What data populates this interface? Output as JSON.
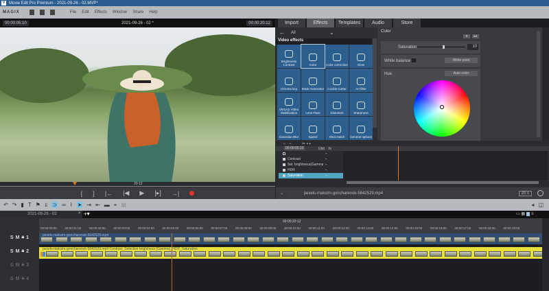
{
  "window": {
    "title": "Movie Edit Pro Premium - 2021-09-26 - 02.MVP*"
  },
  "menu": {
    "brand": "MAGIX",
    "items": [
      "File",
      "Edit",
      "Effects",
      "Window",
      "Share",
      "Help"
    ]
  },
  "preview": {
    "timecode_left": "00:00:05:10",
    "title": "2021-09-26 - 02 *",
    "timecode_right": "00:00:20:12",
    "scrub_time": "20:12",
    "position_fraction": 0.27
  },
  "tabs": [
    "Import",
    "Effects",
    "Templates",
    "Audio",
    "Store"
  ],
  "active_tab": "Effects",
  "effects": {
    "filter": "All",
    "section": "Video effects",
    "items": [
      "Brightness/ Contrast",
      "Color",
      "Color correction",
      "Glow",
      "Chroma key",
      "Mask Generator",
      "Cookie Cutter",
      "Art filter",
      "VEGAS Video Stabilization",
      "Lens Flare",
      "Distortion",
      "Sharpness",
      "Gaussian Blur",
      "Speed",
      "Shot match",
      "General options"
    ],
    "selected": "Color"
  },
  "color_panel": {
    "title": "Color",
    "saturation_label": "Saturation",
    "saturation_value": "10",
    "white_balance_label": "White balance",
    "white_point_button": "White point",
    "hue_label": "Hue",
    "auto_color_button": "Auto color"
  },
  "keyframes": {
    "timecode": "00:00:05:10",
    "col_unit": "Unit",
    "col_fx": "fx",
    "rows": [
      "",
      "Contrast",
      "Sel. brightness(Gamma)",
      "HDR",
      "Saturation"
    ]
  },
  "bottom": {
    "file": "pexels-maksim-goncharenok-5642529.mp4",
    "zoom": "20 s"
  },
  "project_tab": "2021-09-26 - 02",
  "timeline": {
    "cursor": "00:00:20:12",
    "ticks": [
      "00:00:00:00",
      "00:00:01:00",
      "00:00:02:00",
      "00:00:03:00",
      "00:00:04:00",
      "00:00:05:00",
      "00:00:06:00",
      "00:00:07:00",
      "00:00:08:00",
      "00:00:09:00",
      "00:00:10:00",
      "00:00:11:00",
      "00:00:12:00",
      "00:00:13:00",
      "00:00:14:00",
      "00:00:15:00",
      "00:00:16:00",
      "00:00:17:00",
      "00:00:18:00",
      "00:00:19:00"
    ],
    "track1_label": "pexels-maksim-goncharenok-5642529.mp4",
    "track2_label": "pexels-maksim-goncharenok-5642529.mp4  Contrast_Selective brightness (Gamma)_HDR_Saturation",
    "track_numbers": [
      "1",
      "2",
      "3",
      "4"
    ]
  },
  "colors": {
    "accent": "#2c5f8e",
    "selection": "#e8e23a",
    "record": "#e0342c",
    "playhead": "#e07a2a"
  }
}
